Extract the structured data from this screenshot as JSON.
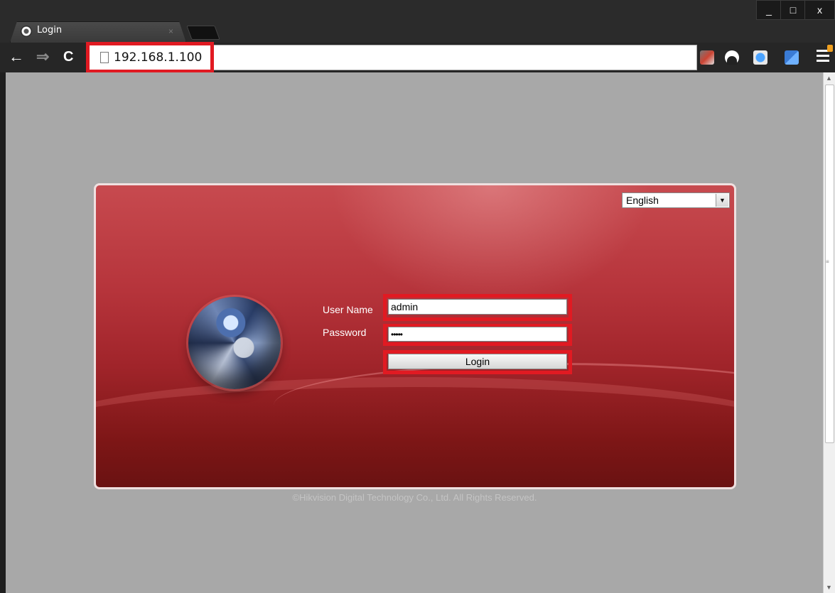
{
  "browser": {
    "tab_title": "Login",
    "tab_close": "×",
    "url": "192.168.1.100",
    "window_controls": {
      "minimize": "_",
      "maximize": "□",
      "close": "x"
    },
    "nav": {
      "back": "←",
      "forward": "⇒",
      "reload": "C"
    },
    "extensions": [
      "extension-icon-1",
      "extension-icon-2",
      "ie-tab-icon",
      "translate-icon"
    ],
    "highlight_color": "#e11a22"
  },
  "login": {
    "language": "English",
    "username_label": "User Name",
    "username_value": "admin",
    "password_label": "Password",
    "password_value": "•••••",
    "login_button": "Login",
    "footer": "©Hikvision Digital Technology Co., Ltd. All Rights Reserved.",
    "panel_color": "#b6343b"
  }
}
